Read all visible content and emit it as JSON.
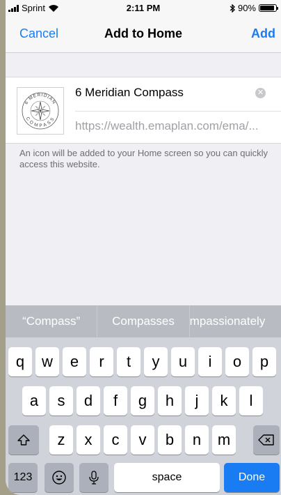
{
  "status_bar": {
    "carrier": "Sprint",
    "time": "2:11 PM",
    "battery": "90%",
    "battery_level": 0.9
  },
  "nav": {
    "cancel_label": "Cancel",
    "title": "Add to Home",
    "add_label": "Add"
  },
  "bookmark": {
    "name": "6 Meridian Compass",
    "url": "https://wealth.emaplan.com/ema/...",
    "logo_text_top": "6 MERIDIAN",
    "logo_text_bottom": "COMPASS"
  },
  "help_text": "An icon will be added to your Home screen so you can quickly access this website.",
  "keyboard": {
    "suggestions": [
      "“Compass”",
      "Compasses",
      "mpassionately"
    ],
    "row1": [
      "q",
      "w",
      "e",
      "r",
      "t",
      "y",
      "u",
      "i",
      "o",
      "p"
    ],
    "row2": [
      "a",
      "s",
      "d",
      "f",
      "g",
      "h",
      "j",
      "k",
      "l"
    ],
    "row3": [
      "z",
      "x",
      "c",
      "v",
      "b",
      "n",
      "m"
    ],
    "numbers_label": "123",
    "space_label": "space",
    "done_label": "Done"
  },
  "colors": {
    "accent": "#1a7cf2",
    "background": "#efeff4"
  }
}
